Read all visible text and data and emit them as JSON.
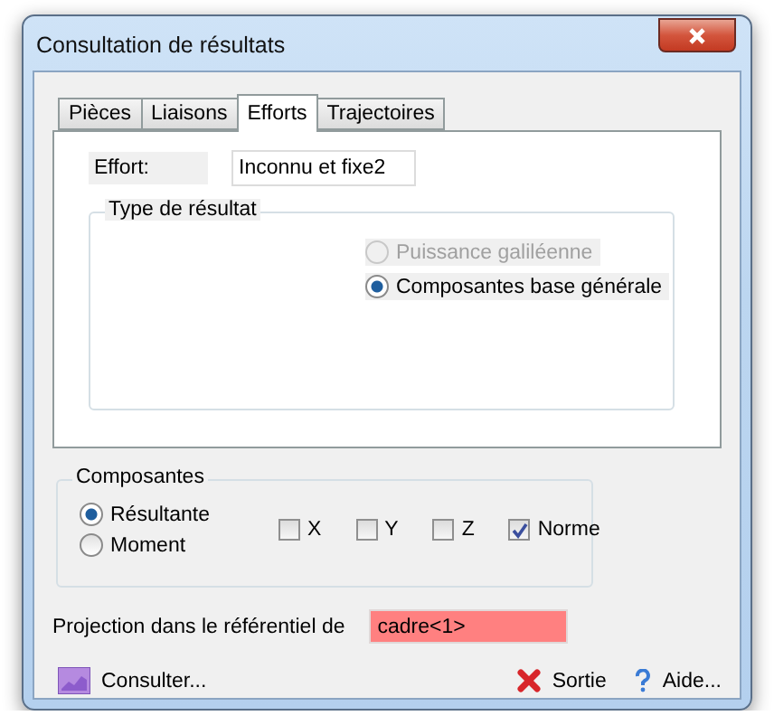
{
  "window": {
    "title": "Consultation de résultats"
  },
  "tabs": [
    {
      "label": "Pièces",
      "selected": false
    },
    {
      "label": "Liaisons",
      "selected": false
    },
    {
      "label": "Efforts",
      "selected": true
    },
    {
      "label": "Trajectoires",
      "selected": false
    }
  ],
  "effort": {
    "label": "Effort:",
    "value": "Inconnu et fixe2"
  },
  "result_type": {
    "title": "Type de résultat",
    "options": [
      {
        "label": "Puissance galiléenne",
        "selected": false,
        "disabled": true
      },
      {
        "label": "Composantes base générale",
        "selected": true,
        "disabled": false
      }
    ]
  },
  "components": {
    "title": "Composantes",
    "radios": [
      {
        "label": "Résultante",
        "selected": true
      },
      {
        "label": "Moment",
        "selected": false
      }
    ],
    "checkboxes": [
      {
        "label": "X",
        "checked": false
      },
      {
        "label": "Y",
        "checked": false
      },
      {
        "label": "Z",
        "checked": false
      },
      {
        "label": "Norme",
        "checked": true
      }
    ]
  },
  "projection": {
    "label": "Projection dans le référentiel de",
    "value": "cadre<1>"
  },
  "buttons": [
    {
      "label": "Consulter...",
      "kind": "consult"
    },
    {
      "label": "Sortie",
      "kind": "exit"
    },
    {
      "label": "Aide...",
      "kind": "help"
    }
  ]
}
